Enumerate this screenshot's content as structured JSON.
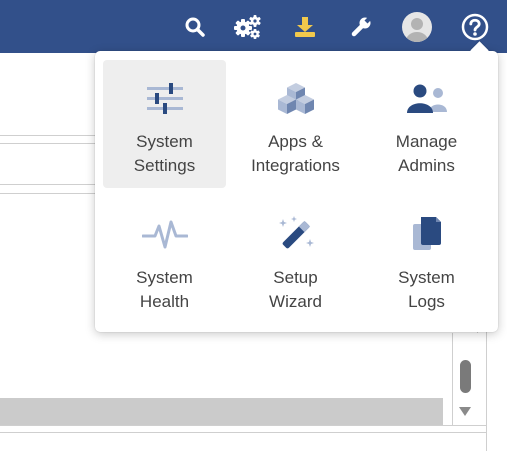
{
  "topbar": {
    "background": "#32508a",
    "icons": [
      {
        "name": "search-icon"
      },
      {
        "name": "cogs-icon"
      },
      {
        "name": "download-icon",
        "color": "#f2c94c"
      },
      {
        "name": "wrench-icon"
      },
      {
        "name": "user-avatar"
      },
      {
        "name": "help-icon"
      }
    ]
  },
  "admin_menu": {
    "items": [
      {
        "icon": "sliders-icon",
        "label_line1": "System",
        "label_line2": "Settings",
        "active": true
      },
      {
        "icon": "cubes-icon",
        "label_line1": "Apps &",
        "label_line2": "Integrations",
        "active": false
      },
      {
        "icon": "users-icon",
        "label_line1": "Manage",
        "label_line2": "Admins",
        "active": false
      },
      {
        "icon": "heartbeat-icon",
        "label_line1": "System",
        "label_line2": "Health",
        "active": false
      },
      {
        "icon": "magic-wand-icon",
        "label_line1": "Setup",
        "label_line2": "Wizard",
        "active": false
      },
      {
        "icon": "files-icon",
        "label_line1": "System",
        "label_line2": "Logs",
        "active": false
      }
    ],
    "icon_dark": "#2a4a80",
    "icon_light": "#a9b8d4"
  }
}
